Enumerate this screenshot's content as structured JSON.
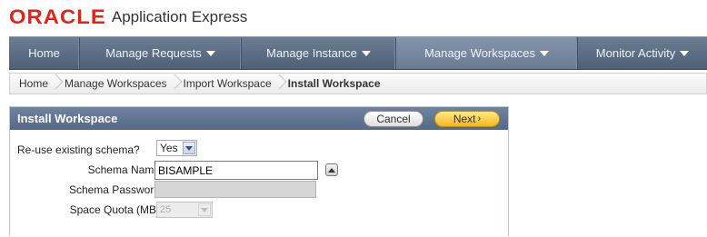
{
  "logo": {
    "brand": "ORACLE",
    "product": "Application Express"
  },
  "nav": {
    "items": [
      {
        "label": "Home"
      },
      {
        "label": "Manage Requests"
      },
      {
        "label": "Manage Instance"
      },
      {
        "label": "Manage Workspaces"
      },
      {
        "label": "Monitor Activity"
      }
    ],
    "active": "Manage Workspaces"
  },
  "breadcrumb": [
    "Home",
    "Manage Workspaces",
    "Import Workspace",
    "Install Workspace"
  ],
  "region": {
    "title": "Install Workspace",
    "cancel_label": "Cancel",
    "next_label": "Next",
    "next_arrow": "›"
  },
  "form": {
    "reuse_label": "Re-use existing schema?",
    "reuse_value": "Yes",
    "schema_name_label": "Schema Name",
    "schema_name_value": "BISAMPLE",
    "schema_password_label": "Schema Password",
    "schema_password_value": "",
    "quota_label": "Space Quota (MB)",
    "quota_value": "25"
  },
  "colors": {
    "brand_red": "#e2231a",
    "nav_bg": "#5b6c82",
    "next_button": "#f5b71c"
  }
}
